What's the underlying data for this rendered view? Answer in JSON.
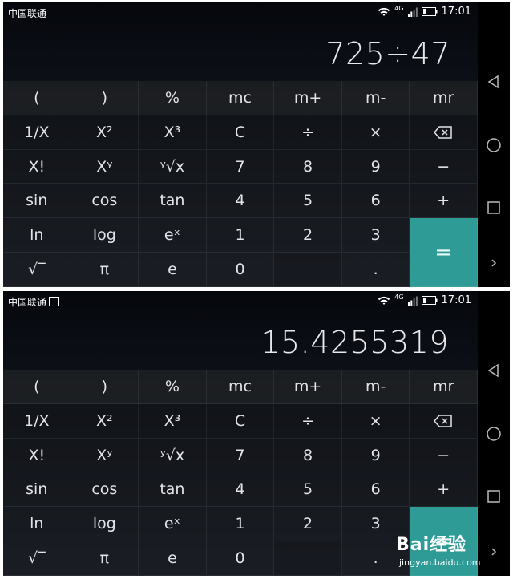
{
  "status": {
    "carrier": "中国联通",
    "network": "4G",
    "time": "17:01"
  },
  "screens": [
    {
      "display": "725÷47"
    },
    {
      "display": "15.4255319"
    }
  ],
  "keypad": [
    [
      "(",
      ")",
      "%",
      "mc",
      "m+",
      "m-",
      "mr"
    ],
    [
      "1/X",
      "X²",
      "X³",
      "C",
      "÷",
      "×",
      "⌫"
    ],
    [
      "X!",
      "Xʸ",
      "ʸ√x",
      "7",
      "8",
      "9",
      "−"
    ],
    [
      "sin",
      "cos",
      "tan",
      "4",
      "5",
      "6",
      "+"
    ],
    [
      "ln",
      "log",
      "eˣ",
      "1",
      "2",
      "3",
      "="
    ],
    [
      "√‾",
      "π",
      "e",
      "0",
      "",
      "."
    ]
  ],
  "icons": {
    "back": "back-triangle-icon",
    "home": "home-circle-icon",
    "recents": "recents-square-icon",
    "more": "chevron-right-icon",
    "delete": "backspace-icon",
    "wifi": "wifi-icon",
    "signal": "signal-icon",
    "battery": "battery-icon"
  },
  "colors": {
    "equals": "#2e9b97",
    "background": "#0d1118"
  },
  "watermark": {
    "brand": "Bai经验",
    "url": "jingyan.baidu.com"
  }
}
